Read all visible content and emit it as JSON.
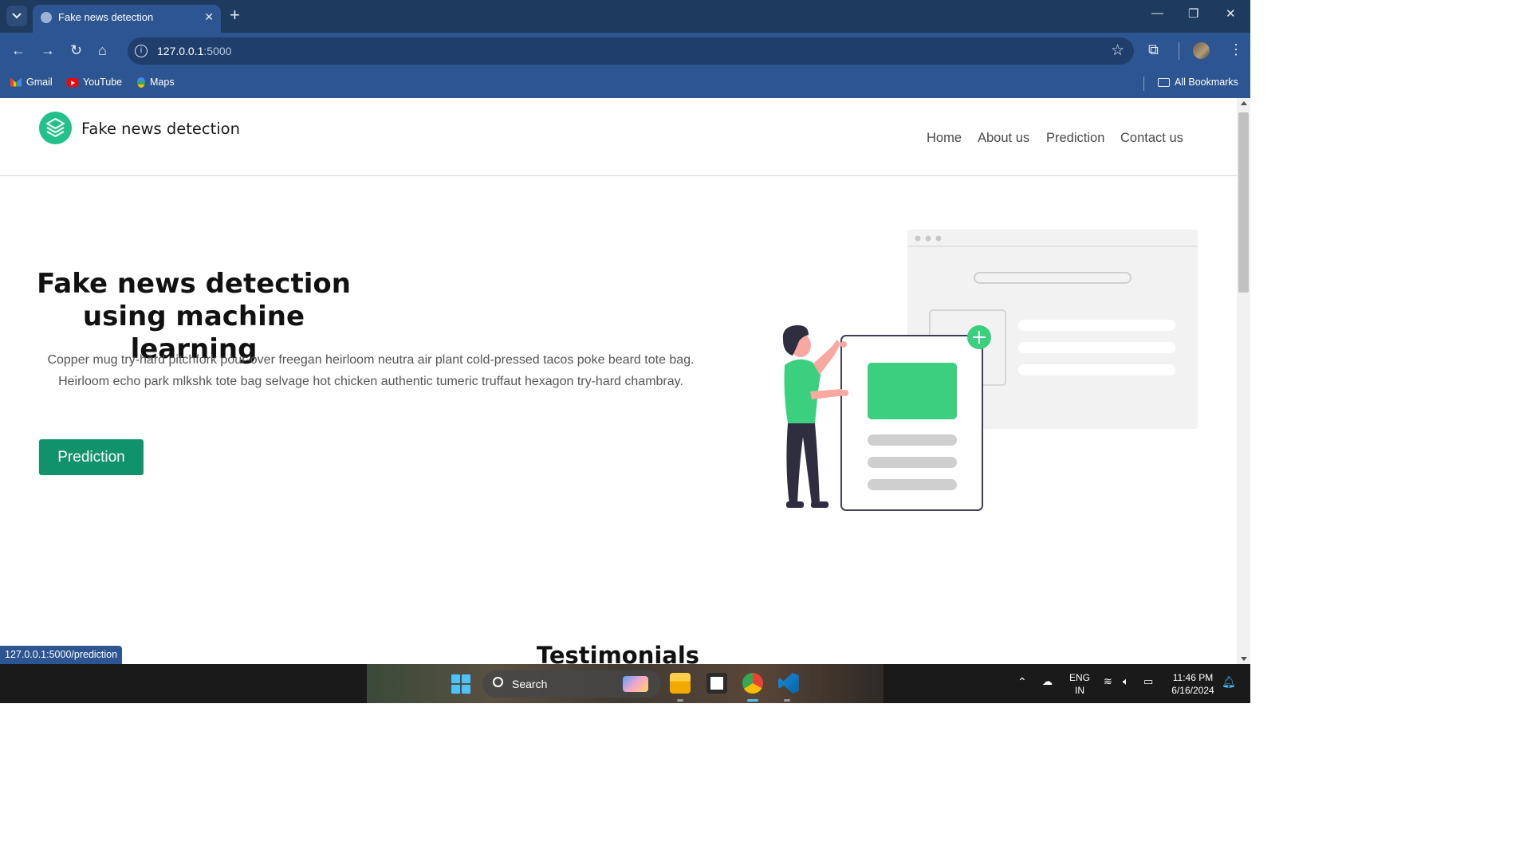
{
  "browser": {
    "tab_title": "Fake news detection",
    "url_host": "127.0.0.1",
    "url_port": ":5000",
    "bookmarks": [
      "Gmail",
      "YouTube",
      "Maps"
    ],
    "all_bookmarks": "All Bookmarks",
    "status_url": "127.0.0.1:5000/prediction"
  },
  "site": {
    "brand": "Fake news detection",
    "nav": [
      "Home",
      "About us",
      "Prediction",
      "Contact us"
    ],
    "hero": {
      "title_line1": "Fake news detection",
      "title_line2": "using machine learning",
      "text": "Copper mug try-hard pitchfork pour-over freegan heirloom neutra air plant cold-pressed tacos poke beard tote bag. Heirloom echo park mlkshk tote bag selvage hot chicken authentic tumeric truffaut hexagon try-hard chambray.",
      "button": "Prediction"
    },
    "section_heading": "Testimonials"
  },
  "taskbar": {
    "search_label": "Search",
    "lang_top": "ENG",
    "lang_bottom": "IN",
    "time": "11:46 PM",
    "date": "6/16/2024"
  },
  "colors": {
    "accent": "#10936a",
    "logo_green": "#22c08a",
    "browser_frame": "#2c5591"
  }
}
